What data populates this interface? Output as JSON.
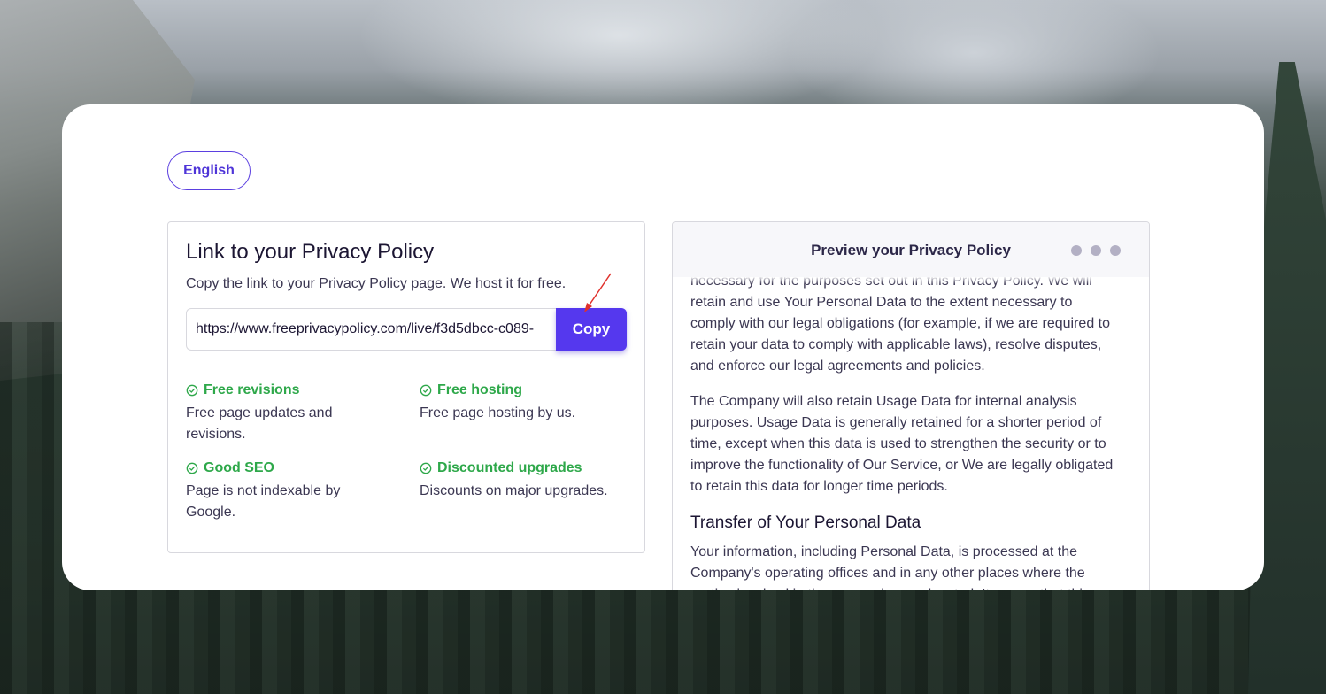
{
  "language_button": {
    "label": "English"
  },
  "link_panel": {
    "title": "Link to your Privacy Policy",
    "subtitle": "Copy the link to your Privacy Policy page. We host it for free.",
    "url_value": "https://www.freeprivacypolicy.com/live/f3d5dbcc-c089-",
    "copy_label": "Copy",
    "features": [
      {
        "title": "Free revisions",
        "description": "Free page updates and revisions."
      },
      {
        "title": "Free hosting",
        "description": "Free page hosting by us."
      },
      {
        "title": "Good SEO",
        "description": "Page is not indexable by Google."
      },
      {
        "title": "Discounted upgrades",
        "description": "Discounts on major upgrades."
      }
    ]
  },
  "preview_panel": {
    "title": "Preview your Privacy Policy",
    "paragraphs": [
      "necessary for the purposes set out in this Privacy Policy. We will retain and use Your Personal Data to the extent necessary to comply with our legal obligations (for example, if we are required to retain your data to comply with applicable laws), resolve disputes, and enforce our legal agreements and policies.",
      "The Company will also retain Usage Data for internal analysis purposes. Usage Data is generally retained for a shorter period of time, except when this data is used to strengthen the security or to improve the functionality of Our Service, or We are legally obligated to retain this data for longer time periods."
    ],
    "section_heading": "Transfer of Your Personal Data",
    "section_paragraph": "Your information, including Personal Data, is processed at the Company's operating offices and in any other places where the parties involved in the processing are located. It means that this"
  },
  "colors": {
    "accent": "#5538ee",
    "feature_green": "#2ea84a",
    "text_dark": "#1c1633"
  },
  "icons": {
    "feature": "check-circle-icon",
    "annotation": "red-arrow-icon"
  }
}
